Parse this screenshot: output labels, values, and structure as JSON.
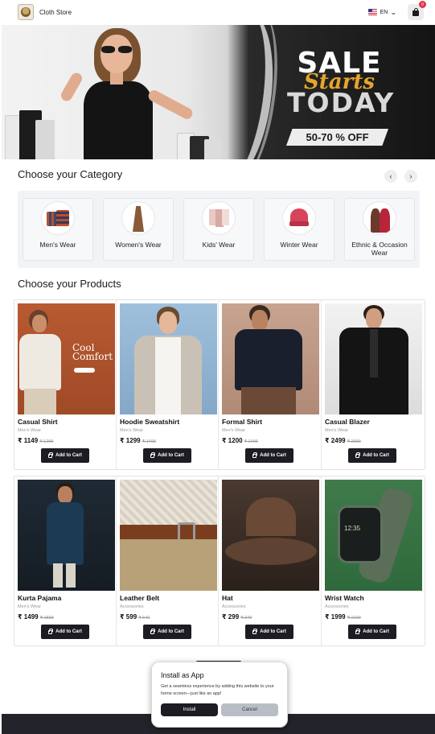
{
  "header": {
    "store_name": "Cloth Store",
    "language": "EN",
    "cart_count": "0"
  },
  "banner": {
    "sale": "SALE",
    "starts": "Starts",
    "today": "TODAY",
    "discount": "50-70 % OFF"
  },
  "categories": {
    "title": "Choose your Category",
    "prev": "‹",
    "next": "›",
    "items": [
      {
        "label": "Men's Wear"
      },
      {
        "label": "Women's Wear"
      },
      {
        "label": "Kids' Wear"
      },
      {
        "label": "Winter Wear"
      },
      {
        "label": "Ethnic & Occasion Wear"
      }
    ]
  },
  "products": {
    "title": "Choose your Products",
    "add_label": "Add to Cart",
    "items": [
      {
        "name": "Casual Shirt",
        "category": "Men's Wear",
        "price": "₹ 1149",
        "old_price": "₹ 1299",
        "image_text": "Cool Comfort"
      },
      {
        "name": "Hoodie Sweatshirt",
        "category": "Men's Wear",
        "price": "₹ 1299",
        "old_price": "₹ 1499"
      },
      {
        "name": "Formal Shirt",
        "category": "Men's Wear",
        "price": "₹ 1200",
        "old_price": "₹ 1499"
      },
      {
        "name": "Casual Blazer",
        "category": "Men's Wear",
        "price": "₹ 2499",
        "old_price": "₹ 2999"
      },
      {
        "name": "Kurta Pajama",
        "category": "Men's Wear",
        "price": "₹ 1499",
        "old_price": "₹ 1899"
      },
      {
        "name": "Leather Belt",
        "category": "Accessories",
        "price": "₹ 599",
        "old_price": "₹ 649"
      },
      {
        "name": "Hat",
        "category": "Accessories",
        "price": "₹ 299",
        "old_price": "₹ 349"
      },
      {
        "name": "Wrist Watch",
        "category": "Accessories",
        "price": "₹ 1999",
        "old_price": "₹ 2199",
        "watch_time": "12:35"
      }
    ]
  },
  "install_popup": {
    "title": "Install as App",
    "text": "Get a seamless experience by adding this website to your home screen—just like an app!",
    "install_label": "Install",
    "cancel_label": "Cancel"
  },
  "colors": {
    "accent_dark": "#1c1c22",
    "sale_gold": "#e6a52c",
    "badge_red": "#e0344a"
  }
}
